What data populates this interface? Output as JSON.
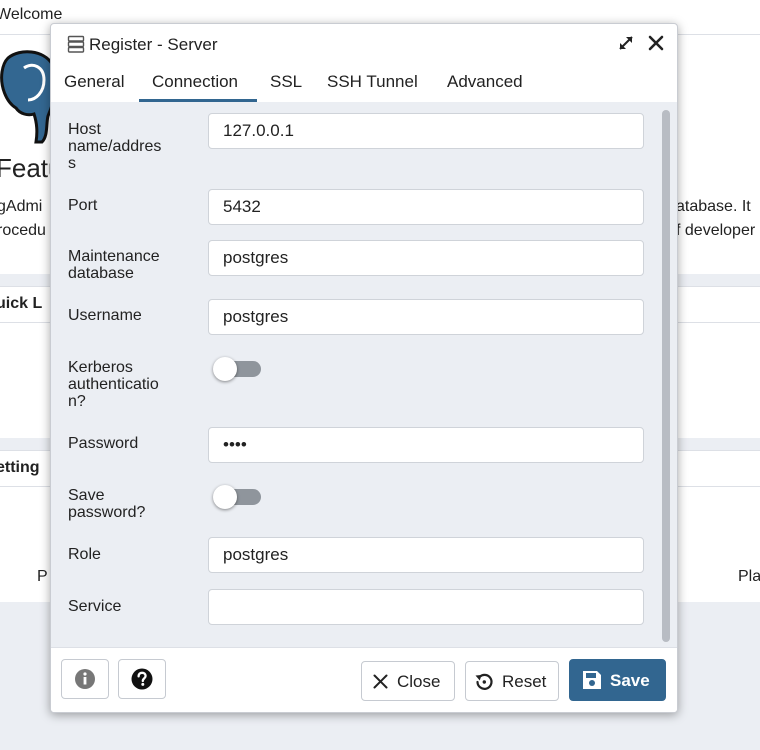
{
  "background": {
    "tab_label": "Welcome",
    "featu_text": "Featu",
    "desc_left_1": "gAdmi",
    "desc_left_2": "rocedu",
    "desc_right_1": "atabase. It",
    "desc_right_2": "f developer",
    "quick_links_title": "uick L",
    "settings_title": "etting",
    "p_left": "P",
    "pla_right": "Pla"
  },
  "dialog": {
    "title": "Register - Server",
    "title_icon": "server-icon",
    "tabs": [
      {
        "label": "General"
      },
      {
        "label": "Connection"
      },
      {
        "label": "SSL"
      },
      {
        "label": "SSH Tunnel"
      },
      {
        "label": "Advanced"
      }
    ],
    "active_tab": "Connection",
    "fields": {
      "host": {
        "label_1": "Host",
        "label_2": "name/addres",
        "label_3": "s",
        "value": "127.0.0.1"
      },
      "port": {
        "label": "Port",
        "value": "5432"
      },
      "maintenance_db": {
        "label_1": "Maintenance",
        "label_2": "database",
        "value": "postgres"
      },
      "username": {
        "label": "Username",
        "value": "postgres"
      },
      "kerberos": {
        "label_1": "Kerberos",
        "label_2": "authenticatio",
        "label_3": "n?",
        "enabled": false
      },
      "password": {
        "label": "Password",
        "value": "••••"
      },
      "save_password": {
        "label_1": "Save",
        "label_2": "password?",
        "enabled": false
      },
      "role": {
        "label": "Role",
        "value": "postgres"
      },
      "service": {
        "label": "Service",
        "value": ""
      }
    },
    "footer": {
      "close_label": "Close",
      "reset_label": "Reset",
      "save_label": "Save"
    }
  },
  "colors": {
    "accent": "#326690",
    "panel_bg": "#ebeef3",
    "toggle_off": "#8f959c"
  }
}
